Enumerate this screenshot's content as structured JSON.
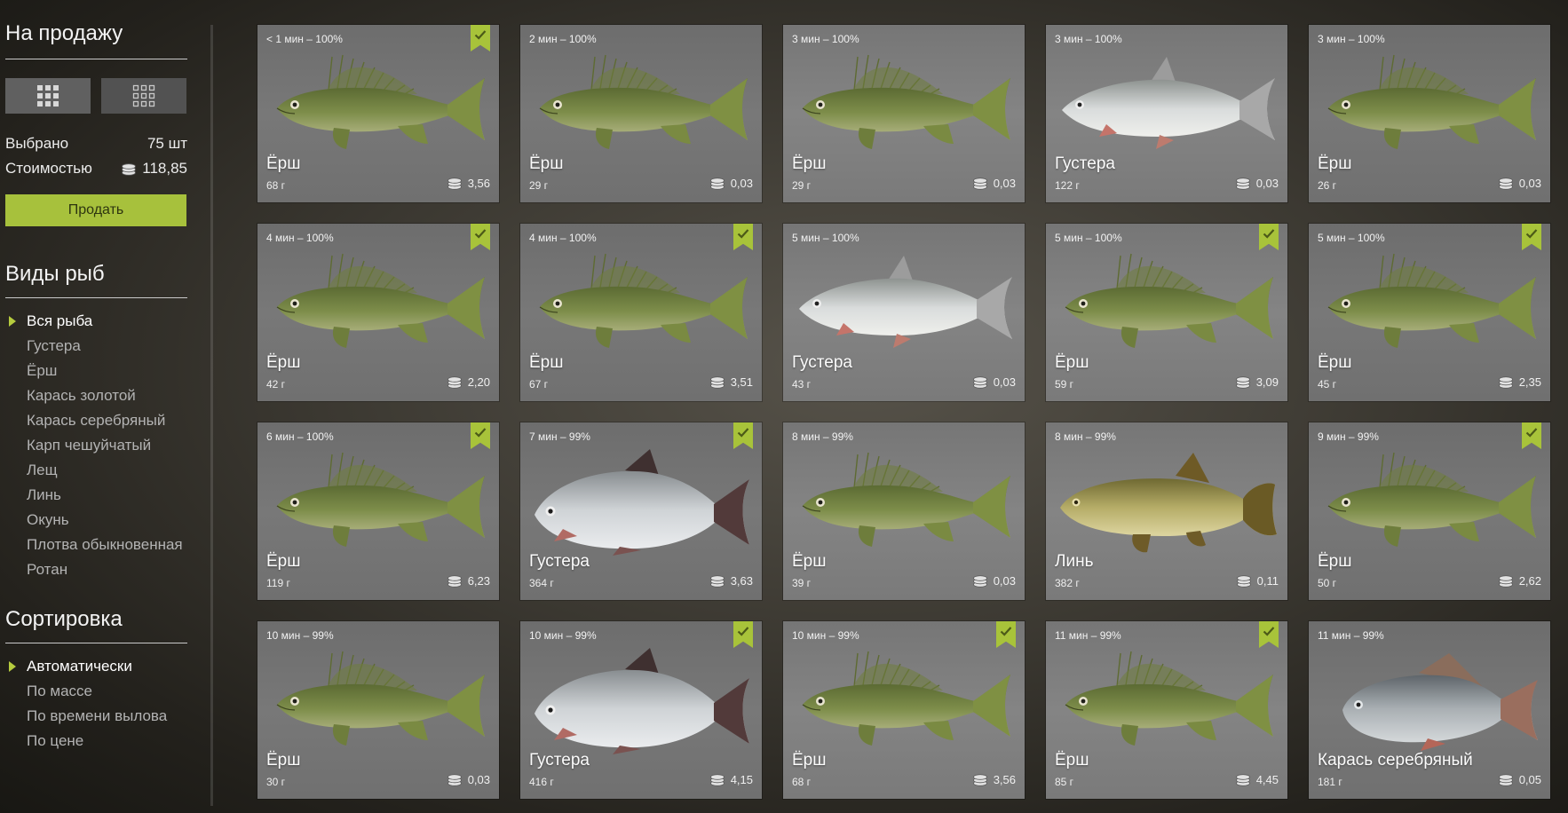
{
  "sidebar": {
    "sale_title": "На продажу",
    "selected_label": "Выбрано",
    "selected_value": "75 шт",
    "cost_label": "Стоимостью",
    "cost_value": "118,85",
    "sell_label": "Продать",
    "species_title": "Виды рыб",
    "species": [
      "Вся рыба",
      "Густера",
      "Ёрш",
      "Карась золотой",
      "Карась серебряный",
      "Карп чешуйчатый",
      "Лещ",
      "Линь",
      "Окунь",
      "Плотва обыкновенная",
      "Ротан"
    ],
    "species_active": 0,
    "sort_title": "Сортировка",
    "sorts": [
      "Автоматически",
      "По массе",
      "По времени вылова",
      "По цене"
    ],
    "sort_active": 0
  },
  "colors": {
    "accent": "#a8c33a",
    "card_bg": "#737373",
    "sell_button": "#a7c13c"
  },
  "fish_cards": [
    {
      "time": "< 1 мин – 100%",
      "name": "Ёрш",
      "weight": "68 г",
      "price": "3,56",
      "selected": true,
      "kind": "ruffe"
    },
    {
      "time": "2 мин – 100%",
      "name": "Ёрш",
      "weight": "29 г",
      "price": "0,03",
      "selected": false,
      "kind": "ruffe"
    },
    {
      "time": "3 мин – 100%",
      "name": "Ёрш",
      "weight": "29 г",
      "price": "0,03",
      "selected": false,
      "kind": "ruffe"
    },
    {
      "time": "3 мин – 100%",
      "name": "Густера",
      "weight": "122 г",
      "price": "0,03",
      "selected": false,
      "kind": "bream"
    },
    {
      "time": "3 мин – 100%",
      "name": "Ёрш",
      "weight": "26 г",
      "price": "0,03",
      "selected": false,
      "kind": "ruffe"
    },
    {
      "time": "4 мин – 100%",
      "name": "Ёрш",
      "weight": "42 г",
      "price": "2,20",
      "selected": true,
      "kind": "ruffe"
    },
    {
      "time": "4 мин – 100%",
      "name": "Ёрш",
      "weight": "67 г",
      "price": "3,51",
      "selected": true,
      "kind": "ruffe"
    },
    {
      "time": "5 мин – 100%",
      "name": "Густера",
      "weight": "43 г",
      "price": "0,03",
      "selected": false,
      "kind": "bream"
    },
    {
      "time": "5 мин – 100%",
      "name": "Ёрш",
      "weight": "59 г",
      "price": "3,09",
      "selected": true,
      "kind": "ruffe"
    },
    {
      "time": "5 мин – 100%",
      "name": "Ёрш",
      "weight": "45 г",
      "price": "2,35",
      "selected": true,
      "kind": "ruffe"
    },
    {
      "time": "6 мин – 100%",
      "name": "Ёрш",
      "weight": "119 г",
      "price": "6,23",
      "selected": true,
      "kind": "ruffe"
    },
    {
      "time": "7 мин – 99%",
      "name": "Густера",
      "weight": "364 г",
      "price": "3,63",
      "selected": true,
      "kind": "bigbream"
    },
    {
      "time": "8 мин – 99%",
      "name": "Ёрш",
      "weight": "39 г",
      "price": "0,03",
      "selected": false,
      "kind": "ruffe"
    },
    {
      "time": "8 мин – 99%",
      "name": "Линь",
      "weight": "382 г",
      "price": "0,11",
      "selected": false,
      "kind": "tench"
    },
    {
      "time": "9 мин – 99%",
      "name": "Ёрш",
      "weight": "50 г",
      "price": "2,62",
      "selected": true,
      "kind": "ruffe"
    },
    {
      "time": "10 мин – 99%",
      "name": "Ёрш",
      "weight": "30 г",
      "price": "0,03",
      "selected": false,
      "kind": "ruffe"
    },
    {
      "time": "10 мин – 99%",
      "name": "Густера",
      "weight": "416 г",
      "price": "4,15",
      "selected": true,
      "kind": "bigbream"
    },
    {
      "time": "10 мин – 99%",
      "name": "Ёрш",
      "weight": "68 г",
      "price": "3,56",
      "selected": true,
      "kind": "ruffe"
    },
    {
      "time": "11 мин – 99%",
      "name": "Ёрш",
      "weight": "85 г",
      "price": "4,45",
      "selected": true,
      "kind": "ruffe"
    },
    {
      "time": "11 мин – 99%",
      "name": "Карась серебряный",
      "weight": "181 г",
      "price": "0,05",
      "selected": false,
      "kind": "carp"
    }
  ]
}
